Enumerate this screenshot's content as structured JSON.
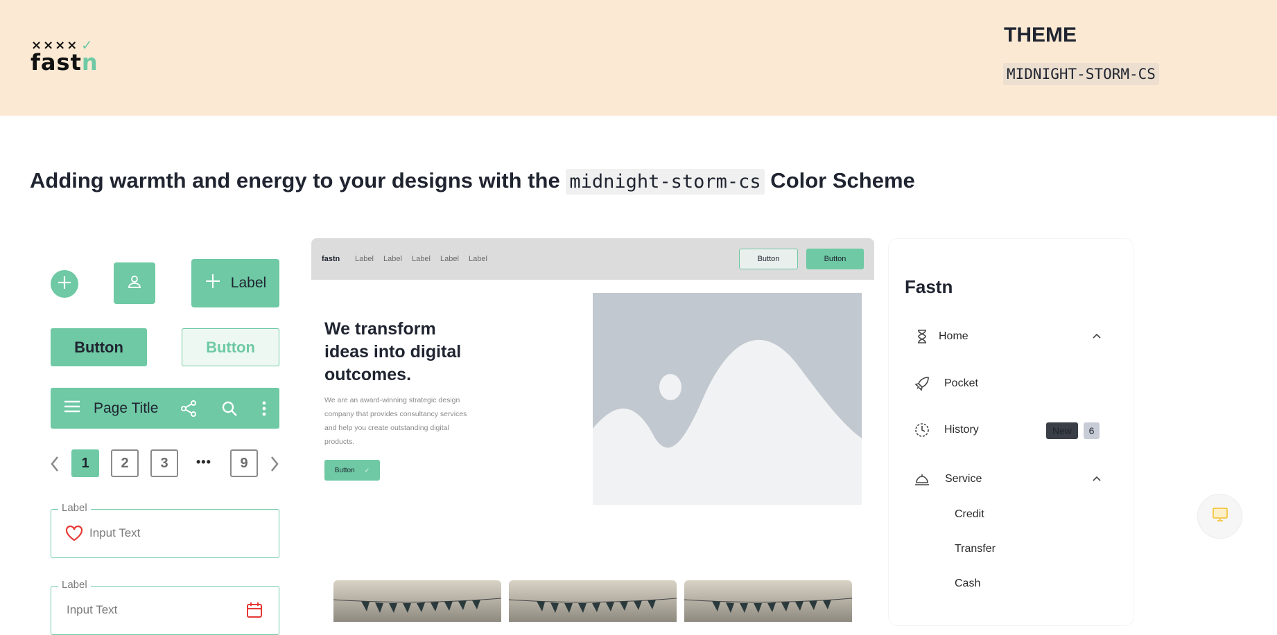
{
  "header": {
    "logo": {
      "crosses": "××××",
      "check": "✓",
      "word_main": "fast",
      "word_accent": "n"
    },
    "theme_title": "THEME",
    "theme_code": "MIDNIGHT-STORM-CS",
    "background": "#fbe9d3"
  },
  "headline": {
    "before": "Adding warmth and energy to your designs with the ",
    "code": "midnight-storm-cs",
    "after": " Color Scheme"
  },
  "colors": {
    "accent": "#6ec9a4",
    "text": "#1f2430",
    "muted": "#7a7a7a"
  },
  "components": {
    "add_icon": "plus-icon",
    "user_icon": "user-icon",
    "label_button": "Label",
    "button_filled": "Button",
    "button_outline": "Button",
    "appbar": {
      "title": "Page Title",
      "icons": [
        "menu-icon",
        "share-icon",
        "search-icon",
        "more-vertical-icon"
      ]
    },
    "pagination": {
      "pages": [
        "1",
        "2",
        "3",
        "9"
      ],
      "ellipsis": "•••",
      "active": "1"
    },
    "input_1": {
      "label": "Label",
      "value": "Input Text",
      "icon": "heart-icon"
    },
    "input_2": {
      "label": "Label",
      "value": "Input Text",
      "icon": "calendar-icon"
    }
  },
  "mockup": {
    "nav": {
      "brand": "fastn",
      "links": [
        "Label",
        "Label",
        "Label",
        "Label",
        "Label"
      ],
      "button_outline": "Button",
      "button_filled": "Button"
    },
    "hero": {
      "heading": "We transform ideas into digital outcomes.",
      "paragraph": "We are an award-winning strategic design company that provides consultancy services and help you create outstanding digital products.",
      "button": "Button",
      "button_check": "✓"
    },
    "image_placeholder": "image-placeholder-icon"
  },
  "sidebar": {
    "title": "Fastn",
    "items": [
      {
        "label": "Home",
        "icon": "hourglass-icon",
        "expanded": true
      },
      {
        "label": "Pocket",
        "icon": "rocket-icon"
      },
      {
        "label": "History",
        "icon": "clock-icon",
        "badge": "New",
        "count": "6"
      },
      {
        "label": "Service",
        "icon": "service-bell-icon",
        "expanded": true
      }
    ],
    "sub_items": [
      "Credit",
      "Transfer",
      "Cash"
    ]
  },
  "floating_button": {
    "icon": "monitor-icon",
    "color": "#f5c542"
  }
}
